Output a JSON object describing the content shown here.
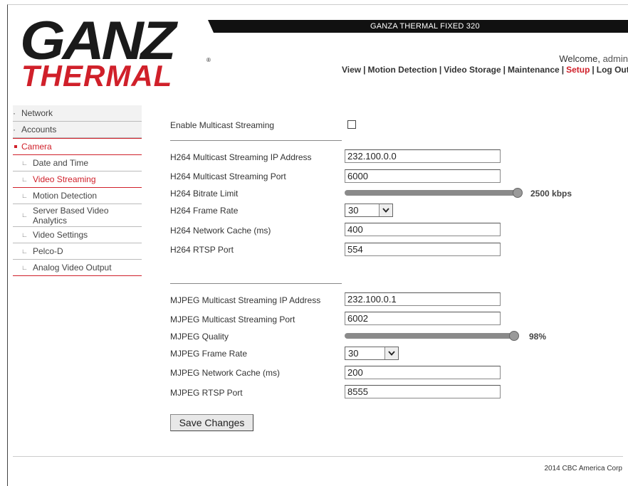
{
  "header": {
    "device_title": "GANZA THERMAL FIXED 320",
    "logo_line1": "GANZ",
    "logo_line2": "THERMAL",
    "welcome_text": "Welcome,",
    "user": "admin"
  },
  "topnav": {
    "items": [
      {
        "label": "View"
      },
      {
        "label": "Motion Detection"
      },
      {
        "label": "Video Storage"
      },
      {
        "label": "Maintenance"
      },
      {
        "label": "Setup",
        "active": true
      },
      {
        "label": "Log Out"
      }
    ],
    "separator": "|"
  },
  "sidebar": {
    "network": "Network",
    "accounts": "Accounts",
    "camera": "Camera",
    "date_time": "Date and Time",
    "video_streaming": "Video Streaming",
    "motion_detection": "Motion Detection",
    "server_analytics_1": "Server Based Video",
    "server_analytics_2": "Analytics",
    "video_settings": "Video Settings",
    "pelco_d": "Pelco-D",
    "analog_output": "Analog Video Output",
    "sub_marker": "∟"
  },
  "form": {
    "enable_multicast_label": "Enable Multicast Streaming",
    "enable_multicast_checked": false,
    "h264": {
      "ip_label": "H264 Multicast Streaming IP Address",
      "ip_value": "232.100.0.0",
      "port_label": "H264 Multicast Streaming Port",
      "port_value": "6000",
      "bitrate_label": "H264 Bitrate Limit",
      "bitrate_value_text": "2500 kbps",
      "bitrate_fraction": 1.0,
      "framerate_label": "H264 Frame Rate",
      "framerate_value": "30",
      "cache_label": "H264 Network Cache (ms)",
      "cache_value": "400",
      "rtsp_label": "H264 RTSP Port",
      "rtsp_value": "554"
    },
    "mjpeg": {
      "ip_label": "MJPEG Multicast Streaming IP Address",
      "ip_value": "232.100.0.1",
      "port_label": "MJPEG Multicast Streaming Port",
      "port_value": "6002",
      "quality_label": "MJPEG Quality",
      "quality_value_text": "98%",
      "quality_fraction": 0.98,
      "framerate_label": "MJPEG Frame Rate",
      "framerate_value": "30",
      "cache_label": "MJPEG Network Cache (ms)",
      "cache_value": "200",
      "rtsp_label": "MJPEG RTSP Port",
      "rtsp_value": "8555"
    },
    "save_label": "Save Changes"
  },
  "footer": {
    "copyright": "2014 CBC America Corp"
  },
  "colors": {
    "accent": "#d0202a",
    "header_bar": "#111111"
  },
  "icons": {
    "dropdown": "chevron-down-icon",
    "sidebar_sub": "sub-item-marker-icon"
  }
}
